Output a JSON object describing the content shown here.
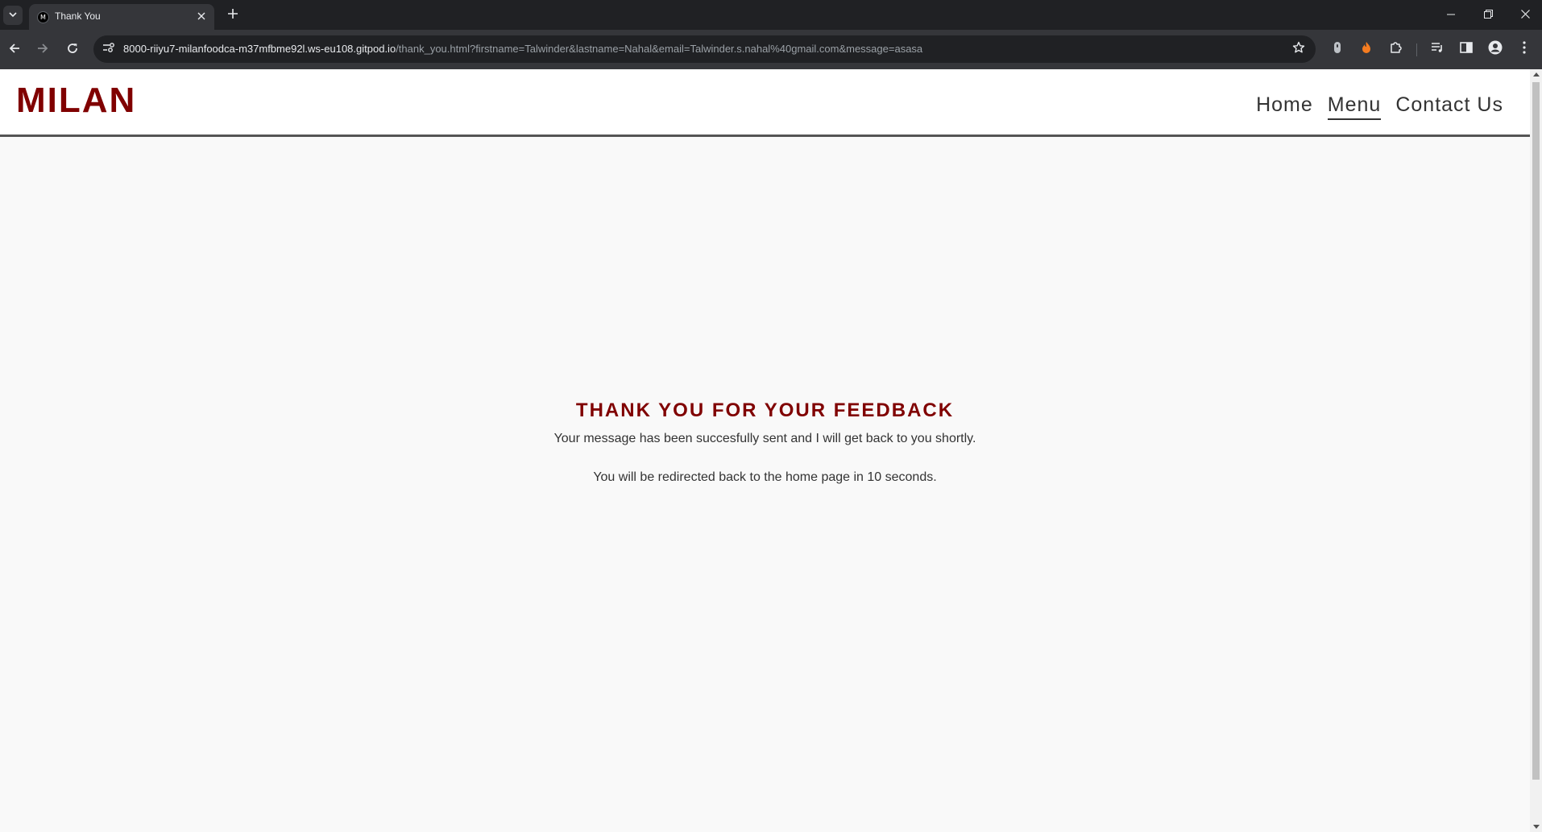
{
  "browser": {
    "tab": {
      "title": "Thank You",
      "favicon_letter": "M"
    },
    "url": {
      "host": "8000-riiyu7-milanfoodca-m37mfbme92l.ws-eu108.gitpod.io",
      "path": "/thank_you.html?firstname=Talwinder&lastname=Nahal&email=Talwinder.s.nahal%40gmail.com&message=asasa"
    },
    "icons": [
      "tab-list-icon",
      "close-icon",
      "plus-icon",
      "minimize-icon",
      "restore-icon",
      "close-window-icon",
      "back-arrow-icon",
      "forward-arrow-icon",
      "reload-icon",
      "site-info-icon",
      "star-icon",
      "extension-icon",
      "puzzle-icon",
      "media-icon",
      "side-panel-icon",
      "profile-icon",
      "more-menu-icon"
    ]
  },
  "header": {
    "logo": "MILAN",
    "nav": [
      {
        "label": "Home"
      },
      {
        "label": "Menu"
      },
      {
        "label": "Contact Us"
      }
    ]
  },
  "main": {
    "title": "THANK YOU FOR YOUR FEEDBACK",
    "body": "Your message has been succesfully sent and I will get back to you shortly.",
    "redirect": "You will be redirected back to the home page in 10 seconds."
  },
  "colors": {
    "brand": "#800000",
    "text": "#333333",
    "page_bg": "#f9f9f9",
    "chrome_dark": "#202124",
    "chrome_toolbar": "#35363a"
  }
}
